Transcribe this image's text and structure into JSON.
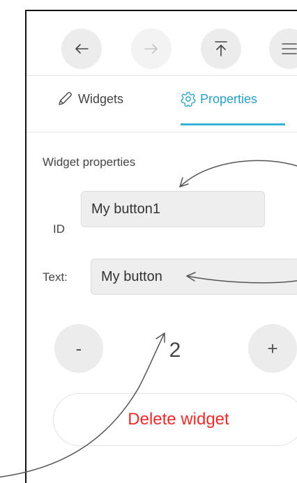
{
  "toolbar": {
    "buttons": [
      {
        "name": "undo",
        "icon": "undo-arrow-icon",
        "enabled": true
      },
      {
        "name": "redo",
        "icon": "redo-arrow-icon",
        "enabled": false
      },
      {
        "name": "upload",
        "icon": "upload-icon",
        "enabled": true
      },
      {
        "name": "menu",
        "icon": "hamburger-menu-icon",
        "enabled": true
      }
    ]
  },
  "tabs": [
    {
      "label": "Widgets",
      "icon": "pencil-icon",
      "active": false
    },
    {
      "label": "Properties",
      "icon": "gear-icon",
      "active": true
    }
  ],
  "properties": {
    "section_title": "Widget properties",
    "id_label": "ID",
    "id_value": "My button1",
    "text_label": "Text:",
    "text_value": "My button",
    "decrement_label": "-",
    "increment_label": "+",
    "stepper_value": "2",
    "delete_label": "Delete widget"
  },
  "colors": {
    "accent": "#39b1d6",
    "delete_text": "#ee2b2b",
    "button_bg": "#ececec"
  }
}
